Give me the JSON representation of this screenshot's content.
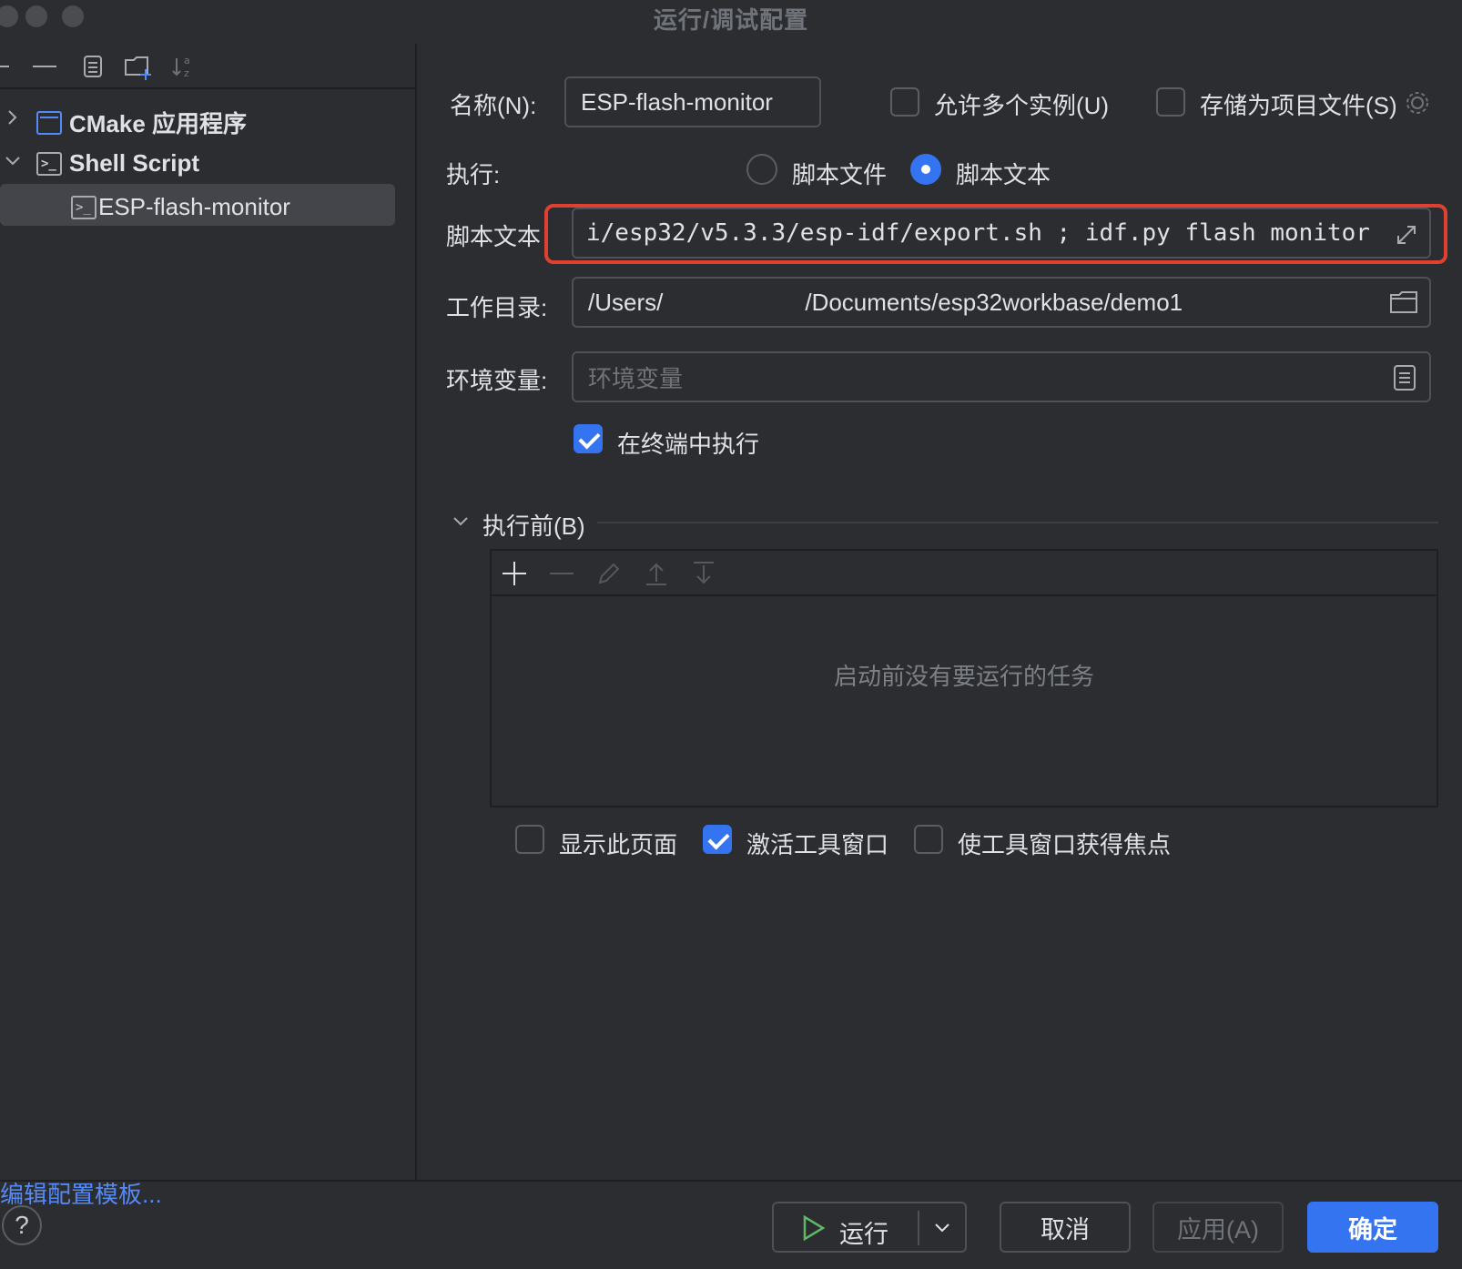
{
  "window": {
    "title": "运行/调试配置"
  },
  "left": {
    "toolbar": {
      "add": "+",
      "remove": "—",
      "sort": "↓a z"
    },
    "tree": [
      {
        "label": "CMake 应用程序",
        "expanded": false,
        "icon": "cmake-app-icon"
      },
      {
        "label": "Shell Script",
        "expanded": true,
        "icon": "shell-script-icon"
      },
      {
        "label": "ESP-flash-monitor",
        "selected": true,
        "icon": "shell-script-icon"
      }
    ],
    "edit_templates": "编辑配置模板..."
  },
  "form": {
    "name_label": "名称(N):",
    "name_value": "ESP-flash-monitor",
    "allow_parallel_label": "允许多个实例(U)",
    "allow_parallel_checked": false,
    "store_as_file_label": "存储为项目文件(S)",
    "store_as_file_checked": false,
    "execute_label": "执行:",
    "option_script_file": "脚本文件",
    "option_script_text": "脚本文本",
    "selected_option": "脚本文本",
    "script_text_label": "脚本文本",
    "script_text_value": "i/esp32/v5.3.3/esp-idf/export.sh ; idf.py flash monitor",
    "workdir_label": "工作目录:",
    "workdir_value": "/Users/      /Documents/esp32workbase/demo1",
    "env_label": "环境变量:",
    "env_placeholder": "环境变量",
    "run_in_terminal_label": "在终端中执行",
    "run_in_terminal_checked": true
  },
  "before_launch": {
    "title": "执行前(B)",
    "empty_text": "启动前没有要运行的任务",
    "show_page_label": "显示此页面",
    "show_page_checked": false,
    "activate_tool_window_label": "激活工具窗口",
    "activate_tool_window_checked": true,
    "focus_tool_window_label": "使工具窗口获得焦点",
    "focus_tool_window_checked": false
  },
  "footer": {
    "help": "?",
    "run": "运行",
    "cancel": "取消",
    "apply": "应用(A)",
    "ok": "确定"
  },
  "colors": {
    "accent": "#3574f0",
    "highlight": "#e0402f",
    "background": "#2b2d30"
  }
}
